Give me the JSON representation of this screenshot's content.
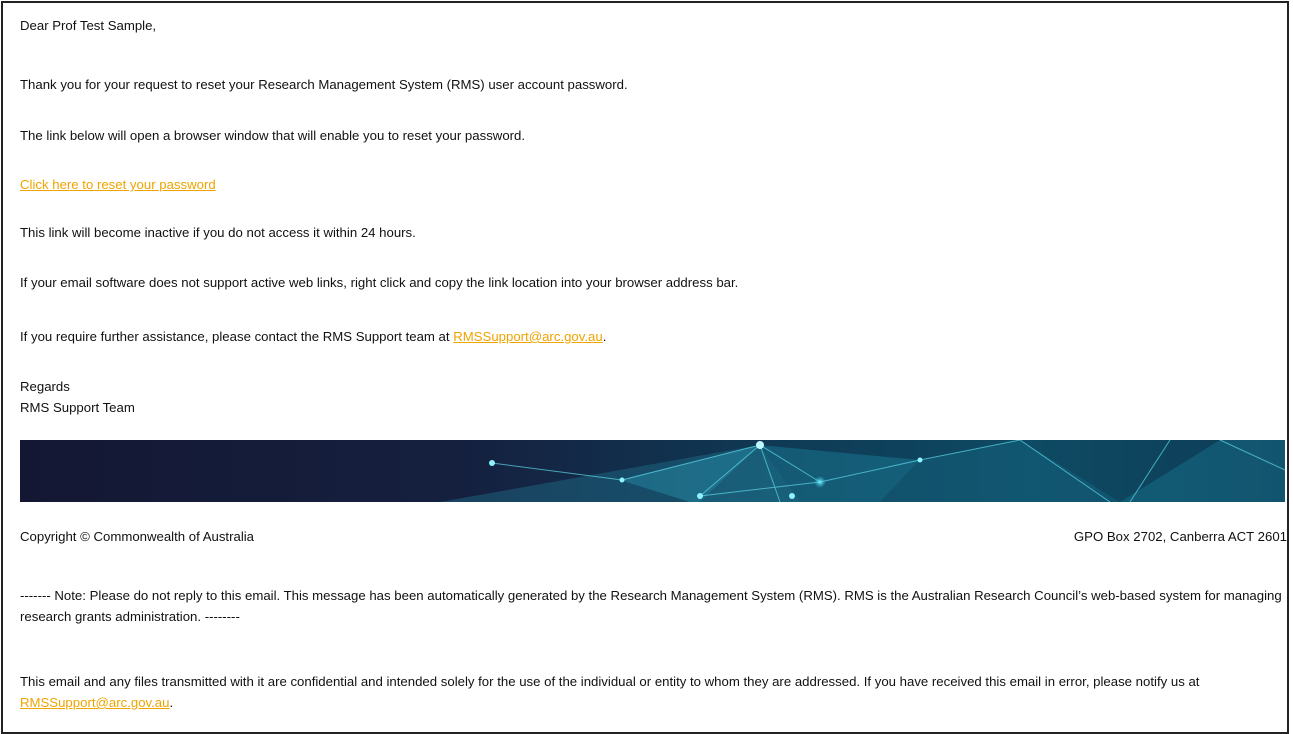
{
  "email": {
    "greeting": "Dear Prof Test Sample,",
    "para1": "Thank you for your request to reset your Research Management System (RMS) user account password.",
    "para2": "The link below will open a browser window that will enable you to reset your password.",
    "reset_link": "Click here to reset your password",
    "para3": "This link will become inactive if you do not access it within 24 hours.",
    "para4": "If your email software does not support active web links, right click and copy the link location into your browser address bar.",
    "para5_prefix": "If you require further assistance, please contact the RMS Support team at ",
    "support_email": "RMSSupport@arc.gov.au",
    "para5_suffix": ".",
    "regards": "Regards",
    "signature": "RMS Support Team"
  },
  "footer": {
    "copyright": "Copyright © Commonwealth of Australia",
    "address": "GPO Box 2702, Canberra ACT 2601",
    "note": "------- Note: Please do not reply to this email. This message has been automatically generated by the Research Management System (RMS). RMS is the Australian Research Council’s web-based system for managing research grants administration. --------",
    "confidential_prefix": "This email and any files transmitted with it are confidential and intended solely for the use of the individual or entity to whom they are addressed. If you have received this email in error, please notify us at ",
    "confidential_email": "RMSSupport@arc.gov.au",
    "confidential_suffix": "."
  },
  "colors": {
    "link": "#f0a400",
    "banner_base": "#14183a",
    "banner_accent": "#2fc4d8"
  }
}
